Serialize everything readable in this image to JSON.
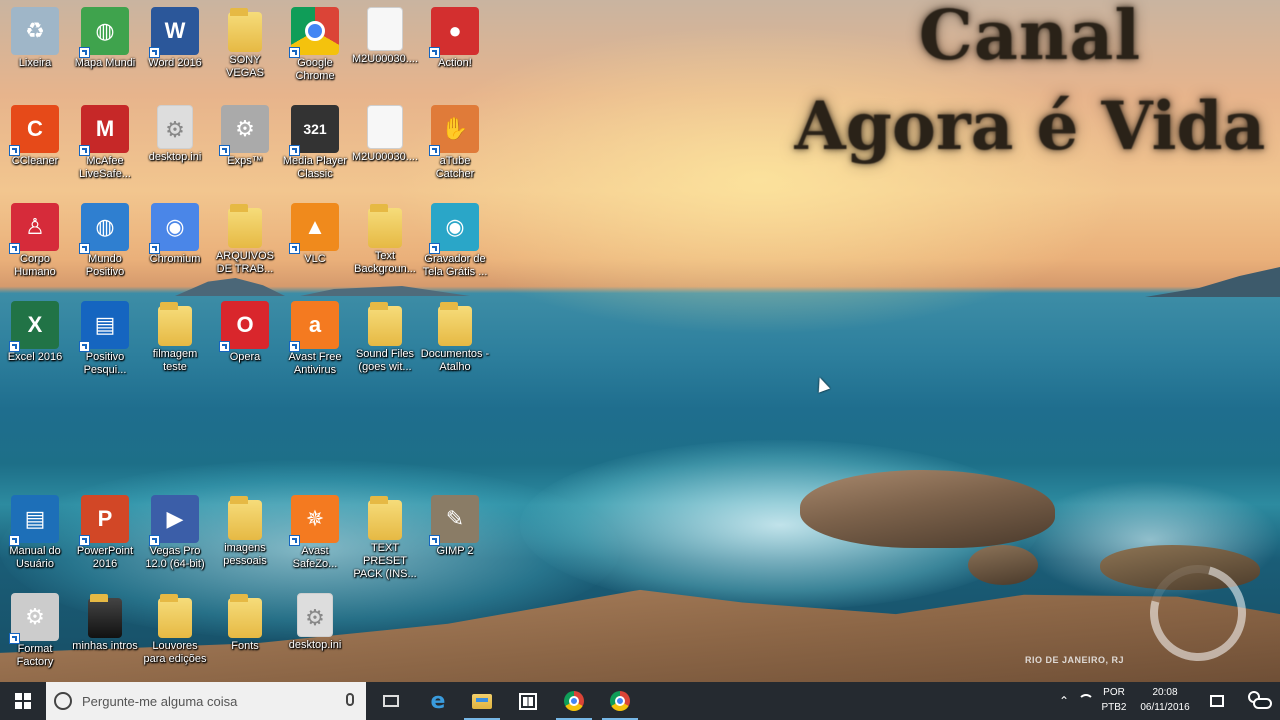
{
  "overlay": {
    "title_line1": "Canal",
    "title_line2": "Agora é Vida",
    "location": "RIO DE JANEIRO, RJ"
  },
  "desktop_icons": [
    {
      "label": "Lixeira",
      "icon": "recycle-bin-icon",
      "color": "#9fb6c8"
    },
    {
      "label": "Mapa Mundi",
      "icon": "globe-icon",
      "color": "#3fa34d"
    },
    {
      "label": "Word 2016",
      "icon": "word-icon",
      "color": "#2b579a"
    },
    {
      "label": "SONY VEGAS",
      "icon": "folder-icon",
      "color": "#e6b944"
    },
    {
      "label": "Google Chrome",
      "icon": "chrome-icon",
      "color": "#4285f4"
    },
    {
      "label": "M2U00030....",
      "icon": "file-icon",
      "color": "#f7f7f7"
    },
    {
      "label": "Action!",
      "icon": "record-icon",
      "color": "#d32f2f"
    },
    {
      "label": "CCleaner",
      "icon": "ccleaner-icon",
      "color": "#e64a19"
    },
    {
      "label": "McAfee LiveSafe...",
      "icon": "mcafee-shield-icon",
      "color": "#c62828"
    },
    {
      "label": "desktop.ini",
      "icon": "settings-file-icon",
      "color": "#dddddd"
    },
    {
      "label": "Exps™",
      "icon": "gear-tool-icon",
      "color": "#aaaaaa"
    },
    {
      "label": "Media Player Classic",
      "icon": "media-player-icon",
      "color": "#333333"
    },
    {
      "label": "M2U00030....",
      "icon": "file-icon",
      "color": "#f7f7f7"
    },
    {
      "label": "aTube Catcher",
      "icon": "catcher-glove-icon",
      "color": "#e07b39"
    },
    {
      "label": "Corpo Humano",
      "icon": "human-body-icon",
      "color": "#d62b3a"
    },
    {
      "label": "Mundo Positivo",
      "icon": "globe-icon",
      "color": "#2f7fd0"
    },
    {
      "label": "Chromium",
      "icon": "chromium-icon",
      "color": "#4a86e8"
    },
    {
      "label": "ARQUIVOS DE TRAB...",
      "icon": "folder-icon",
      "color": "#e6b944"
    },
    {
      "label": "VLC",
      "icon": "vlc-cone-icon",
      "color": "#f08a1c"
    },
    {
      "label": "Text Backgroun...",
      "icon": "folder-icon",
      "color": "#e6b944"
    },
    {
      "label": "Gravador de Tela Grátis ...",
      "icon": "screen-recorder-icon",
      "color": "#2aa6c8"
    },
    {
      "label": "Excel 2016",
      "icon": "excel-icon",
      "color": "#217346"
    },
    {
      "label": "Positivo Pesqui...",
      "icon": "book-icon",
      "color": "#1565c0"
    },
    {
      "label": "filmagem teste",
      "icon": "folder-icon",
      "color": "#e6b944"
    },
    {
      "label": "Opera",
      "icon": "opera-icon",
      "color": "#d9262c"
    },
    {
      "label": "Avast Free Antivirus",
      "icon": "avast-icon",
      "color": "#f47a20"
    },
    {
      "label": "Sound Files (goes wit...",
      "icon": "folder-icon",
      "color": "#e6b944"
    },
    {
      "label": "Documentos - Atalho",
      "icon": "folder-icon",
      "color": "#e6b944"
    },
    {
      "label": "Manual do Usuário",
      "icon": "manual-icon",
      "color": "#1d6fb8"
    },
    {
      "label": "PowerPoint 2016",
      "icon": "powerpoint-icon",
      "color": "#d24726"
    },
    {
      "label": "Vegas Pro 12.0 (64-bit)",
      "icon": "vegas-play-icon",
      "color": "#3b5ea8"
    },
    {
      "label": "imagens pessoais",
      "icon": "folder-icon",
      "color": "#e6b944"
    },
    {
      "label": "Avast SafeZo...",
      "icon": "avast-safezone-icon",
      "color": "#f47a20"
    },
    {
      "label": "TEXT PRESET PACK (INS...",
      "icon": "folder-icon",
      "color": "#e6b944"
    },
    {
      "label": "GIMP 2",
      "icon": "gimp-icon",
      "color": "#8a7c66"
    },
    {
      "label": "Format Factory",
      "icon": "format-factory-icon",
      "color": "#cccccc"
    },
    {
      "label": "minhas intros",
      "icon": "folder-icon",
      "color": "#222222"
    },
    {
      "label": "Louvores para edições",
      "icon": "folder-icon",
      "color": "#e6b944"
    },
    {
      "label": "Fonts",
      "icon": "folder-icon",
      "color": "#e6b944"
    },
    {
      "label": "desktop.ini",
      "icon": "settings-file-icon",
      "color": "#dddddd"
    }
  ],
  "taskbar": {
    "search_placeholder": "Pergunte-me alguma coisa",
    "apps": [
      {
        "name": "edge",
        "icon": "edge-icon"
      },
      {
        "name": "file-explorer",
        "icon": "file-explorer-icon"
      },
      {
        "name": "store",
        "icon": "store-icon"
      },
      {
        "name": "chrome",
        "icon": "chrome-icon"
      },
      {
        "name": "chrome-2",
        "icon": "chrome-icon"
      }
    ],
    "tray": {
      "language": "POR",
      "layout": "PTB2",
      "time": "20:08",
      "date": "06/11/2016"
    },
    "accent": "#77b7e6"
  }
}
